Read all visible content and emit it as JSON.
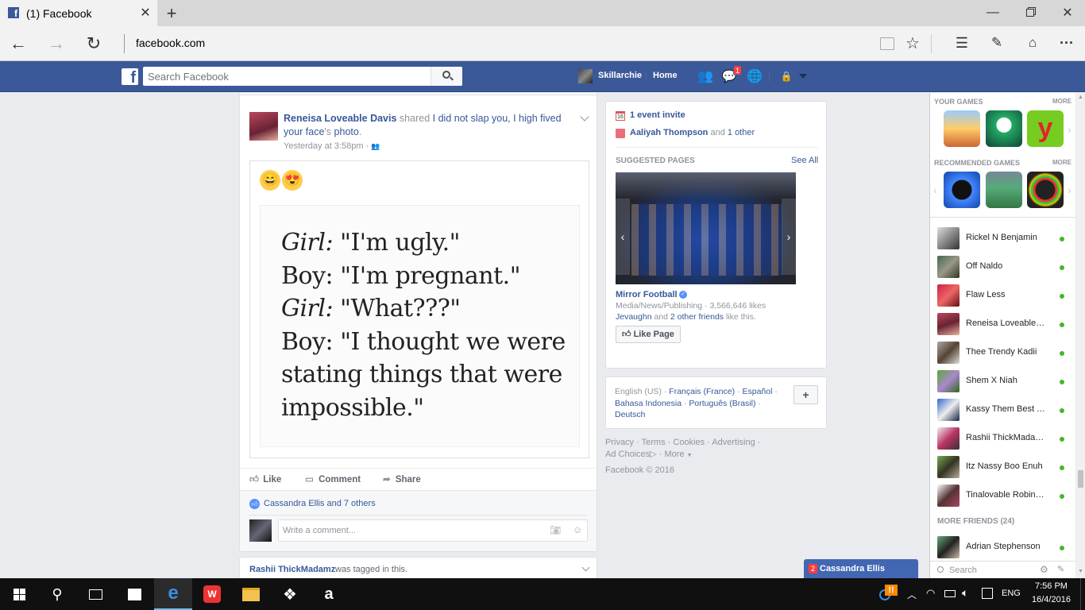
{
  "browser": {
    "tab_title": "(1) Facebook",
    "address": "facebook.com"
  },
  "fb": {
    "search_placeholder": "Search Facebook",
    "user": "Skillarchie",
    "home": "Home",
    "notif_count": "1"
  },
  "post": {
    "author": "Reneisa Loveable Davis",
    "shared": "shared",
    "shared_link": "I did not slap you, I high fived your face",
    "poss": "'s",
    "photo": "photo",
    "period": ".",
    "time": "Yesterday at 3:58pm",
    "sep": "·",
    "quote_lines": [
      {
        "speaker": "Girl:",
        "text": " \"I'm ugly.\""
      },
      {
        "speaker": "Boy:",
        "text": " \"I'm pregnant.\""
      },
      {
        "speaker": "Girl:",
        "text": " \"What???\""
      },
      {
        "speaker": "Boy:",
        "text": " \"I thought we were"
      },
      {
        "speaker": "",
        "text": "stating things that were"
      },
      {
        "speaker": "",
        "text": "impossible.\""
      }
    ],
    "like": "Like",
    "comment": "Comment",
    "share": "Share",
    "likers": "Cassandra Ellis and 7 others",
    "comment_placeholder": "Write a comment..."
  },
  "next_post": {
    "author": "Rashii ThickMadamz",
    "text": "was tagged in this."
  },
  "events": {
    "invite": "1 event invite",
    "birthday_name": "Aaliyah Thompson",
    "birthday_and": "and",
    "birthday_other": "1 other",
    "cal_day": "16"
  },
  "suggested": {
    "header": "SUGGESTED PAGES",
    "see_all": "See All",
    "page_name": "Mirror Football",
    "category": "Media/News/Publishing · 3,566,646 likes",
    "friend": "Jevaughn",
    "and": "and",
    "others": "2 other friends",
    "like_this": "like this.",
    "like_page": "Like Page"
  },
  "languages": {
    "current": "English (US)",
    "links": [
      "Français (France)",
      "Español",
      "Bahasa Indonesia",
      "Português (Brasil)",
      "Deutsch"
    ],
    "plus": "+"
  },
  "footer": {
    "l1": [
      "Privacy",
      "Terms",
      "Cookies",
      "Advertising"
    ],
    "adchoices": "Ad Choices",
    "more": "More",
    "copyright": "Facebook © 2016"
  },
  "games": {
    "your_games": "YOUR GAMES",
    "recommended": "RECOMMENDED GAMES",
    "more": "MORE"
  },
  "chat": {
    "friends": [
      "Rickel N Benjamin",
      "Off Naldo",
      "Flaw Less",
      "Reneisa Loveable Davis",
      "Thee Trendy Kadii",
      "Shem X Niah",
      "Kassy Them Best Tings",
      "Rashii ThickMadamz",
      "Itz Nassy Boo Enuh",
      "Tinalovable Robinson"
    ],
    "more_friends": "MORE FRIENDS (24)",
    "more_friend": "Adrian Stephenson",
    "search": "Search",
    "tab_count": "2",
    "tab_name": "Cassandra Ellis"
  },
  "taskbar": {
    "time": "7:56 PM",
    "date": "16/4/2016",
    "lang": "ENG"
  },
  "colors": {
    "fb_blue": "#3b5998",
    "link": "#365899",
    "online": "#42b72a"
  }
}
